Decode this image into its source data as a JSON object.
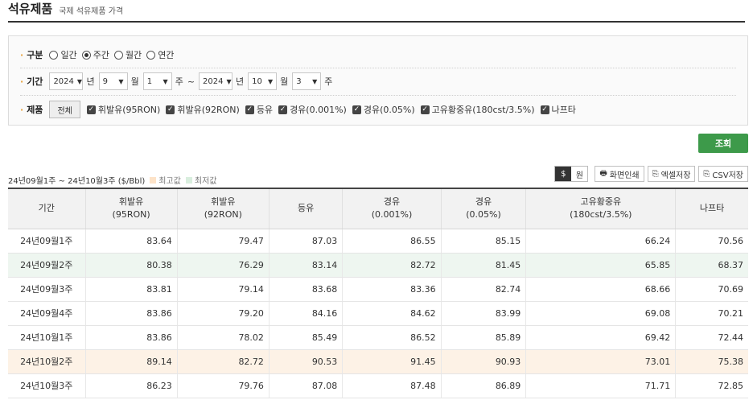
{
  "header": {
    "title": "석유제품",
    "subtitle": "국제 석유제품 가격"
  },
  "filters": {
    "period_type_label": "구분",
    "period_types": [
      {
        "label": "일간",
        "selected": false
      },
      {
        "label": "주간",
        "selected": true
      },
      {
        "label": "월간",
        "selected": false
      },
      {
        "label": "연간",
        "selected": false
      }
    ],
    "range_label": "기간",
    "start": {
      "year": "2024",
      "year_unit": "년",
      "month": "9",
      "month_unit": "월",
      "week": "1",
      "week_unit": "주"
    },
    "tilde": "~",
    "end": {
      "year": "2024",
      "year_unit": "년",
      "month": "10",
      "month_unit": "월",
      "week": "3",
      "week_unit": "주"
    },
    "product_label": "제품",
    "all_button": "전체",
    "products": [
      {
        "label": "휘발유(95RON)",
        "checked": true
      },
      {
        "label": "휘발유(92RON)",
        "checked": true
      },
      {
        "label": "등유",
        "checked": true
      },
      {
        "label": "경유(0.001%)",
        "checked": true
      },
      {
        "label": "경유(0.05%)",
        "checked": true
      },
      {
        "label": "고유황중유(180cst/3.5%)",
        "checked": true
      },
      {
        "label": "나프타",
        "checked": true
      }
    ]
  },
  "search_button": "조회",
  "info": {
    "range_text": "24년09월1주 ~ 24년10월3주 ($/Bbl)",
    "legend_high": "최고값",
    "legend_low": "최저값",
    "high_color": "#fde3c8",
    "low_color": "#d9eede"
  },
  "tools": {
    "unit_dollar": "$",
    "unit_won": "원",
    "print": "화면인쇄",
    "excel": "엑셀저장",
    "csv": "CSV저장"
  },
  "table": {
    "headers": [
      {
        "line1": "기간",
        "line2": ""
      },
      {
        "line1": "휘발유",
        "line2": "(95RON)"
      },
      {
        "line1": "휘발유",
        "line2": "(92RON)"
      },
      {
        "line1": "등유",
        "line2": ""
      },
      {
        "line1": "경유",
        "line2": "(0.001%)"
      },
      {
        "line1": "경유",
        "line2": "(0.05%)"
      },
      {
        "line1": "고유황중유",
        "line2": "(180cst/3.5%)"
      },
      {
        "line1": "나프타",
        "line2": ""
      }
    ],
    "rows": [
      {
        "period": "24년09월1주",
        "values": [
          "83.64",
          "79.47",
          "87.03",
          "86.55",
          "85.15",
          "66.24",
          "70.56"
        ],
        "mark": ""
      },
      {
        "period": "24년09월2주",
        "values": [
          "80.38",
          "76.29",
          "83.14",
          "82.72",
          "81.45",
          "65.85",
          "68.37"
        ],
        "mark": "low"
      },
      {
        "period": "24년09월3주",
        "values": [
          "83.81",
          "79.14",
          "83.68",
          "83.36",
          "82.74",
          "68.66",
          "70.69"
        ],
        "mark": ""
      },
      {
        "period": "24년09월4주",
        "values": [
          "83.86",
          "79.20",
          "84.16",
          "84.62",
          "83.99",
          "69.08",
          "70.21"
        ],
        "mark": ""
      },
      {
        "period": "24년10월1주",
        "values": [
          "83.86",
          "78.02",
          "85.49",
          "86.52",
          "85.89",
          "69.42",
          "72.44"
        ],
        "mark": ""
      },
      {
        "period": "24년10월2주",
        "values": [
          "89.14",
          "82.72",
          "90.53",
          "91.45",
          "90.93",
          "73.01",
          "75.38"
        ],
        "mark": "high"
      },
      {
        "period": "24년10월3주",
        "values": [
          "86.23",
          "79.76",
          "87.08",
          "87.48",
          "86.89",
          "71.71",
          "72.85"
        ],
        "mark": ""
      }
    ]
  }
}
